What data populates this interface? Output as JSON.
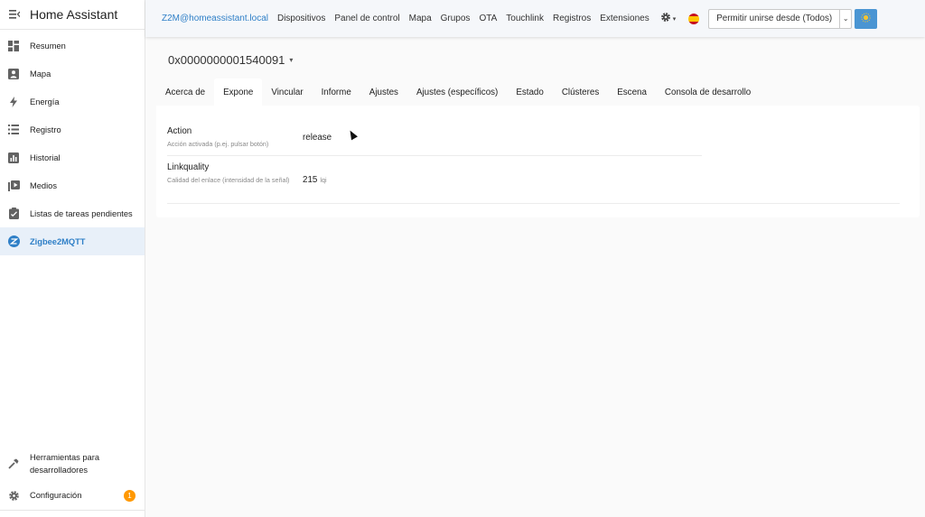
{
  "sidebar": {
    "title": "Home Assistant",
    "items": [
      {
        "label": "Resumen",
        "icon": "dashboard-icon"
      },
      {
        "label": "Mapa",
        "icon": "map-icon"
      },
      {
        "label": "Energía",
        "icon": "lightning-icon"
      },
      {
        "label": "Registro",
        "icon": "list-icon"
      },
      {
        "label": "Historial",
        "icon": "chart-icon"
      },
      {
        "label": "Medios",
        "icon": "media-icon"
      },
      {
        "label": "Listas de tareas pendientes",
        "icon": "clipboard-icon"
      },
      {
        "label": "Zigbee2MQTT",
        "icon": "zigbee-icon",
        "active": true
      }
    ],
    "bottom": [
      {
        "label": "Herramientas para desarrolladores",
        "icon": "hammer-icon"
      },
      {
        "label": "Configuración",
        "icon": "gear-icon",
        "badge": "1"
      }
    ]
  },
  "topbar": {
    "brand": "Z2M@homeassistant.local",
    "links": [
      "Dispositivos",
      "Panel de control",
      "Mapa",
      "Grupos",
      "OTA",
      "Touchlink",
      "Registros",
      "Extensiones"
    ],
    "permit_label": "Permitir unirse desde (Todos)",
    "accent": "#4a95d3"
  },
  "device": {
    "name": "0x0000000001540091"
  },
  "tabs": [
    "Acerca de",
    "Expone",
    "Vincular",
    "Informe",
    "Ajustes",
    "Ajustes (específicos)",
    "Estado",
    "Clústeres",
    "Escena",
    "Consola de desarrollo"
  ],
  "active_tab": "Expone",
  "exposes": [
    {
      "name": "Action",
      "desc": "Acción activada (p.ej. pulsar botón)",
      "value": "release",
      "unit": ""
    },
    {
      "name": "Linkquality",
      "desc": "Calidad del enlace (intensidad de la señal)",
      "value": "215",
      "unit": "lqi"
    }
  ]
}
